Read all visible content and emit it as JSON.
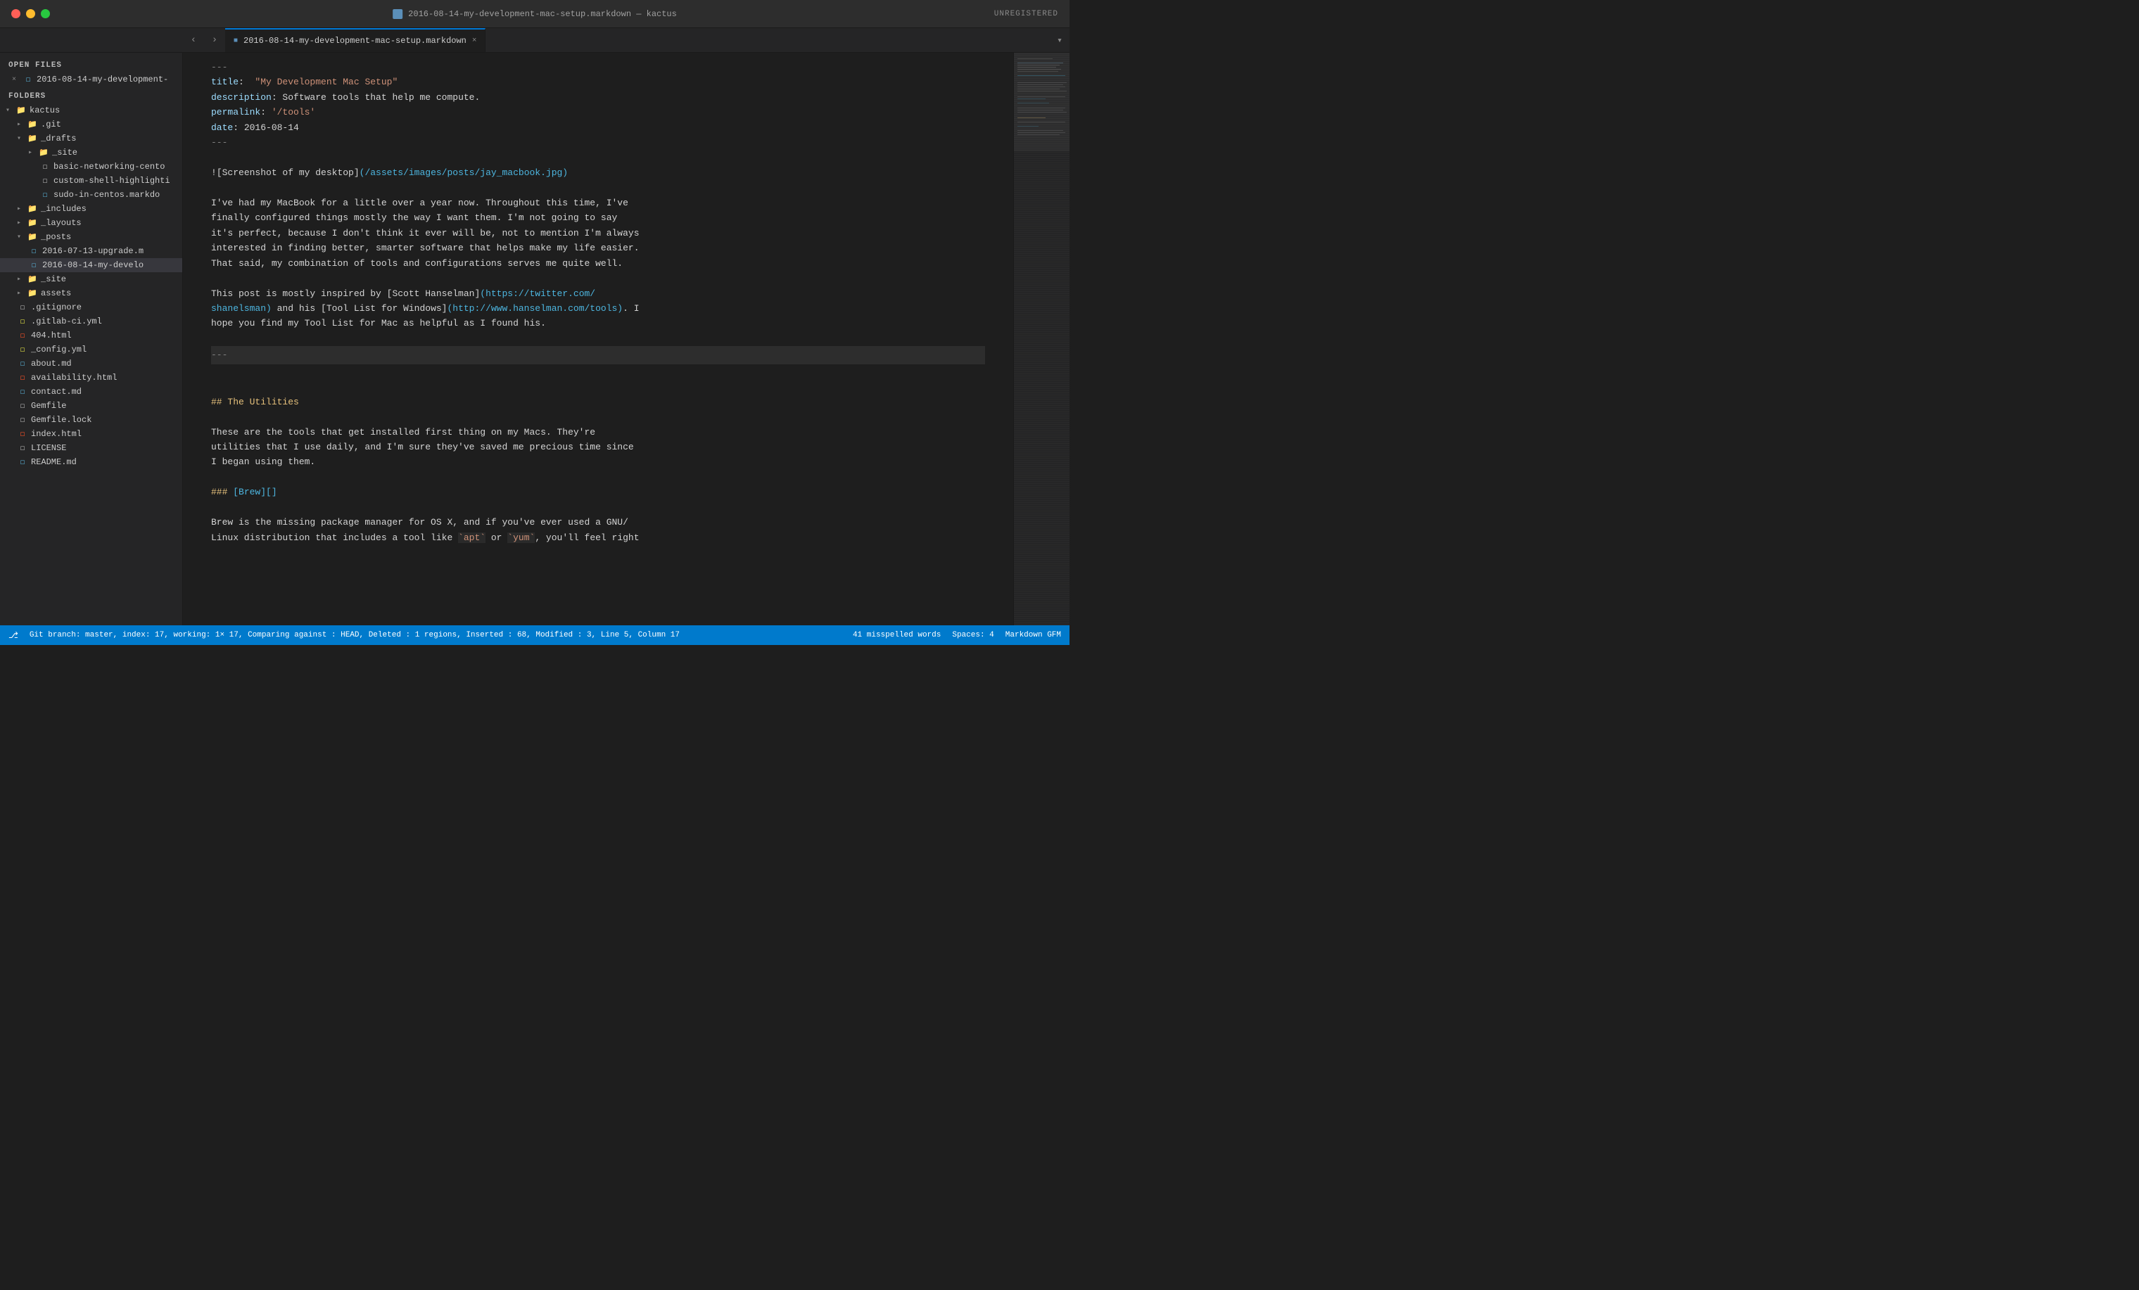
{
  "titlebar": {
    "title": "2016-08-14-my-development-mac-setup.markdown — kactus",
    "registered": "UNREGISTERED"
  },
  "tabs": {
    "active_tab": "2016-08-14-my-development-mac-setup.markdown",
    "close_label": "×"
  },
  "sidebar": {
    "open_files_title": "OPEN FILES",
    "folders_title": "FOLDERS",
    "open_file": "2016-08-14-my-development-",
    "root_folder": "kactus",
    "items": [
      {
        "name": ".git",
        "type": "folder",
        "level": 1,
        "closed": true
      },
      {
        "name": "_drafts",
        "type": "folder",
        "level": 1,
        "open": true
      },
      {
        "name": "_site",
        "type": "folder",
        "level": 2,
        "closed": true
      },
      {
        "name": "basic-networking-cento",
        "type": "file",
        "level": 3
      },
      {
        "name": "custom-shell-highlighti",
        "type": "file",
        "level": 3
      },
      {
        "name": "sudo-in-centos.markdo",
        "type": "file-md",
        "level": 3
      },
      {
        "name": "_includes",
        "type": "folder",
        "level": 1,
        "closed": true
      },
      {
        "name": "_layouts",
        "type": "folder",
        "level": 1,
        "closed": true
      },
      {
        "name": "_posts",
        "type": "folder",
        "level": 1,
        "open": true
      },
      {
        "name": "2016-07-13-upgrade.m",
        "type": "file-md",
        "level": 2
      },
      {
        "name": "2016-08-14-my-develo",
        "type": "file-md",
        "level": 2,
        "active": true
      },
      {
        "name": "_site",
        "type": "folder",
        "level": 1,
        "closed": true
      },
      {
        "name": "assets",
        "type": "folder",
        "level": 1,
        "closed": true
      },
      {
        "name": ".gitignore",
        "type": "file",
        "level": 1
      },
      {
        "name": ".gitlab-ci.yml",
        "type": "file-yml",
        "level": 1
      },
      {
        "name": "404.html",
        "type": "file-html",
        "level": 1
      },
      {
        "name": "_config.yml",
        "type": "file-yml",
        "level": 1
      },
      {
        "name": "about.md",
        "type": "file-md",
        "level": 1
      },
      {
        "name": "availability.html",
        "type": "file-html",
        "level": 1
      },
      {
        "name": "contact.md",
        "type": "file-md",
        "level": 1
      },
      {
        "name": "Gemfile",
        "type": "file",
        "level": 1
      },
      {
        "name": "Gemfile.lock",
        "type": "file",
        "level": 1
      },
      {
        "name": "index.html",
        "type": "file-html",
        "level": 1
      },
      {
        "name": "LICENSE",
        "type": "file",
        "level": 1
      },
      {
        "name": "README.md",
        "type": "file-md",
        "level": 1
      }
    ]
  },
  "editor": {
    "frontmatter_dashes": "---",
    "title_key": "title:",
    "title_val": "\"My Development Mac Setup\"",
    "desc_key": "description:",
    "desc_val": "Software tools that help me compute.",
    "permalink_key": "permalink:",
    "permalink_val": "'/tools'",
    "date_key": "date:",
    "date_val": "2016-08-14",
    "frontmatter_end": "---",
    "image_line": "![Screenshot of my desktop](/assets/images/posts/jay_macbook.jpg)",
    "para1": "I've had my MacBook for a little over a year now. Throughout this time, I've\nfinally configured things mostly the way I want them. I'm not going to say\nit's perfect, because I don't think it ever will be, not to mention I'm always\ninterested in finding better, smarter software that helps make my life easier.\nThat said, my combination of tools and configurations serves me quite well.",
    "para2_prefix": "This post is mostly inspired by [Scott Hanselman](",
    "para2_link1": "https://twitter.com/shanelsman",
    "para2_mid": ") and his [Tool List for Windows](",
    "para2_link2": "http://www.hanselman.com/tools",
    "para2_suffix": "). I\nhope you find my Tool List for Mac as helpful as I found his.",
    "separator": "---",
    "heading_utilities": "## The Utilities",
    "para_utilities": "These are the tools that get installed first thing on my Macs. They're\nutilities that I use daily, and I'm sure they've saved me precious time since\nI began using them.",
    "heading_brew": "### [Brew][]",
    "para_brew": "Brew is the missing package manager for OS X, and if you've ever used a GNU/\nLinux distribution that includes a tool like `apt` or `yum`, you'll feel right"
  },
  "statusbar": {
    "git_info": "Git branch: master, index: 17, working: 1× 17, Comparing against : HEAD, Deleted : 1 regions, Inserted : 68, Modified : 3, Line 5, Column 17",
    "misspelled": "41 misspelled words",
    "spaces": "Spaces: 4",
    "language": "Markdown GFM"
  }
}
